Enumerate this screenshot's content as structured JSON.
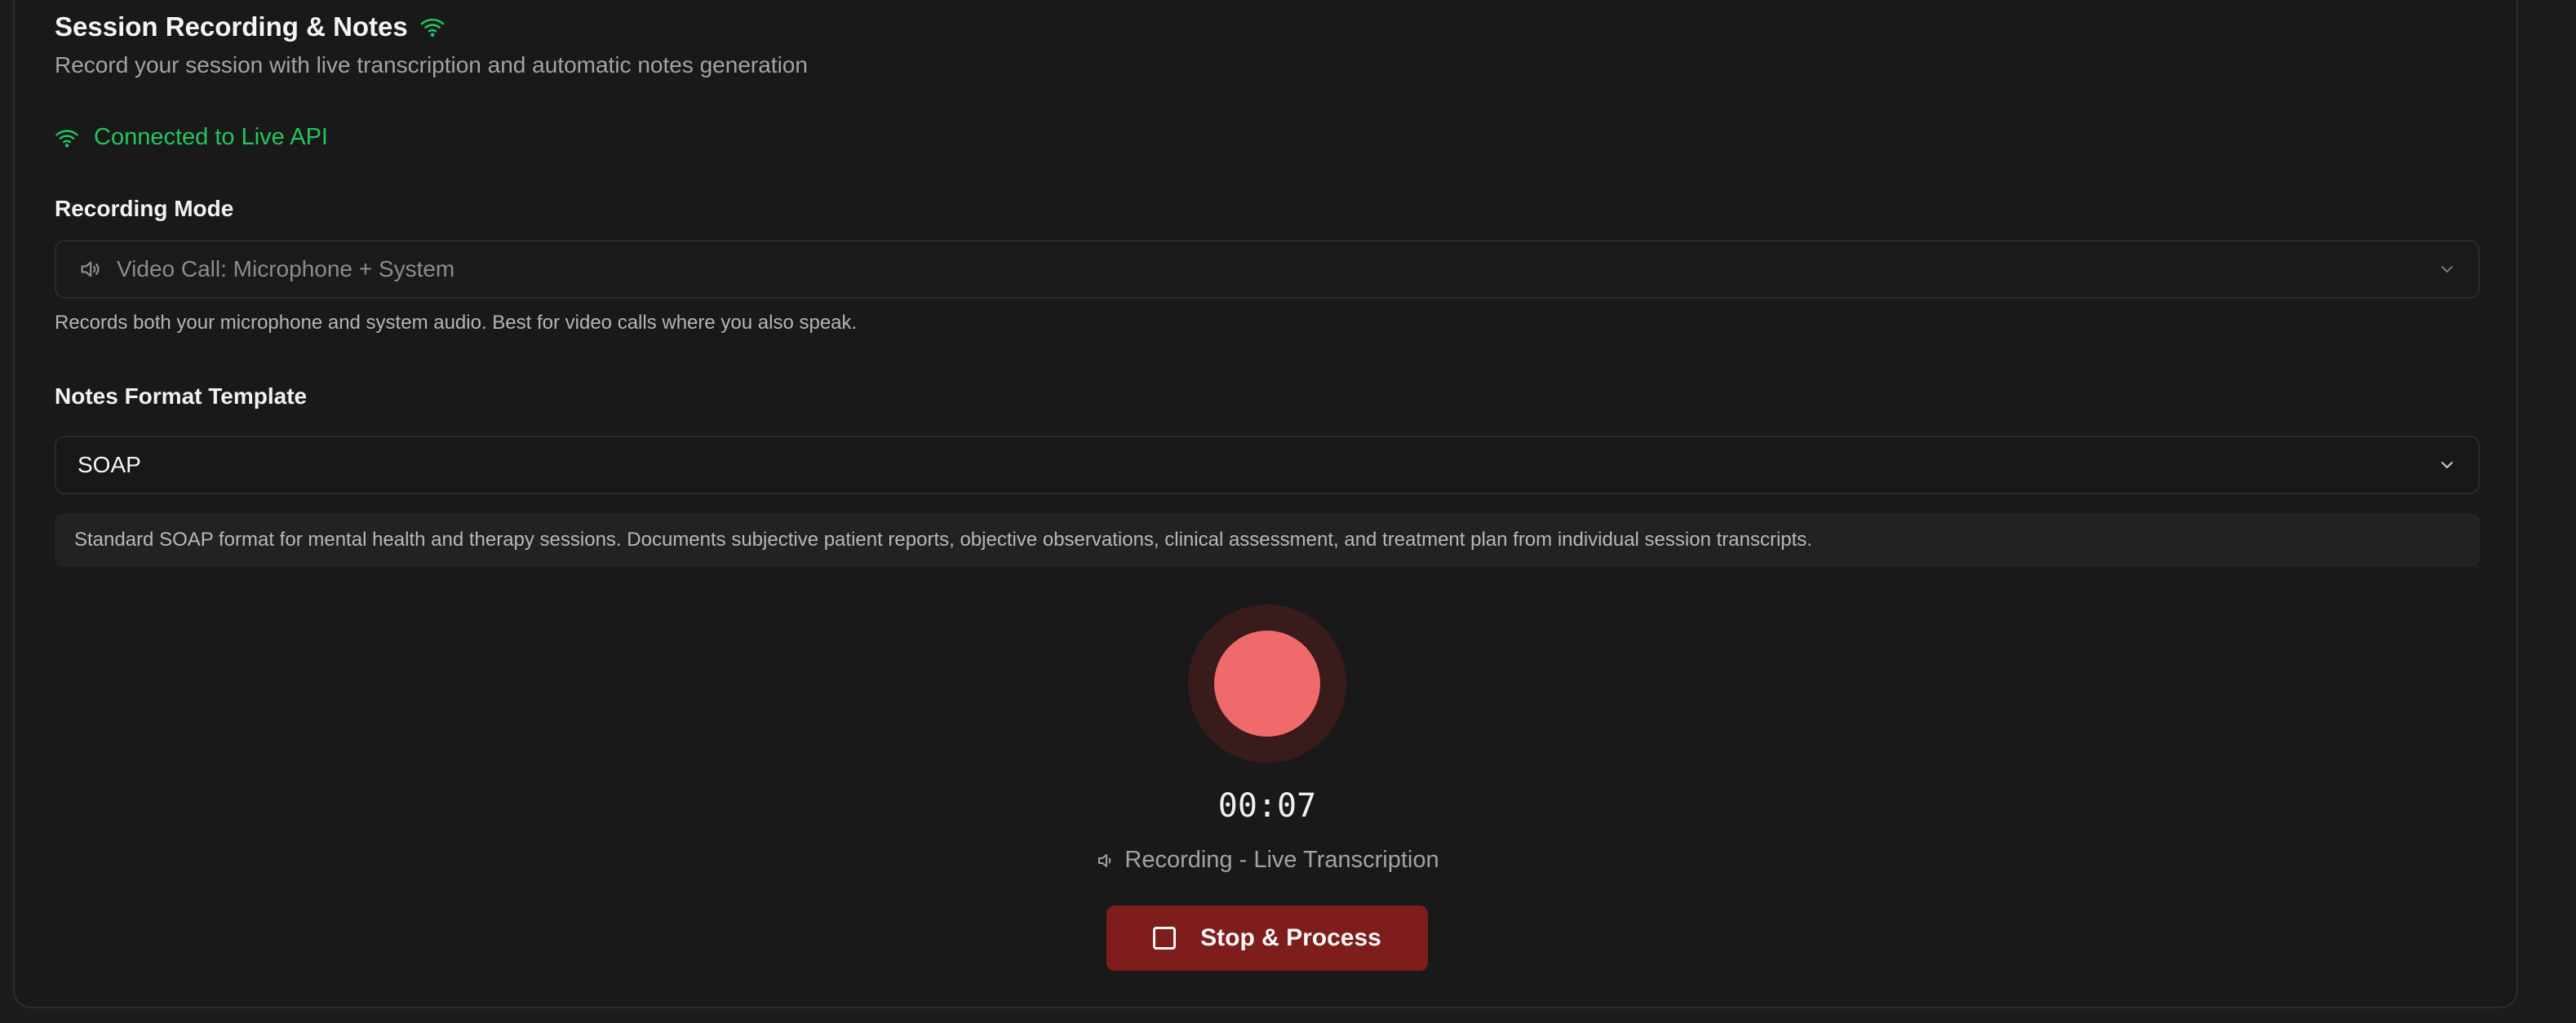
{
  "header": {
    "title": "Session Recording & Notes",
    "subtitle": "Record your session with live transcription and automatic notes generation",
    "title_icon": "wifi-icon"
  },
  "connection": {
    "status_text": "Connected to Live API",
    "icon": "wifi-icon",
    "color": "#22c55e"
  },
  "recording_mode": {
    "label": "Recording Mode",
    "selected": "Video Call: Microphone + System",
    "icon": "speaker-icon",
    "help": "Records both your microphone and system audio. Best for video calls where you also speak."
  },
  "notes_template": {
    "label": "Notes Format Template",
    "selected": "SOAP",
    "description": "Standard SOAP format for mental health and therapy sessions. Documents subjective patient reports, objective observations, clinical assessment, and treatment plan from individual session transcripts."
  },
  "recorder": {
    "timer": "00:07",
    "status": "Recording - Live Transcription",
    "stop_button": "Stop & Process",
    "accent": "#ef6b6b",
    "button_color": "#7f1d1d"
  }
}
